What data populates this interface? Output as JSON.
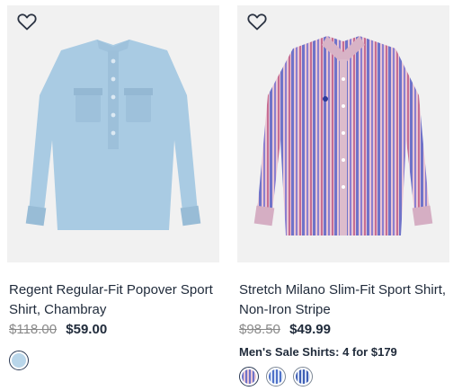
{
  "products": [
    {
      "title": "Regent Regular-Fit Popover Sport Shirt, Chambray",
      "original_price": "$118.00",
      "sale_price": "$59.00",
      "promo": "",
      "favorite_icon": "heart-outline-icon",
      "swatches": [
        {
          "color": "#b9d6ea",
          "selected": true
        }
      ]
    },
    {
      "title": "Stretch Milano Slim-Fit Sport Shirt, Non-Iron Stripe",
      "original_price": "$98.50",
      "sale_price": "$49.99",
      "promo": "Men's Sale Shirts: 4 for $179",
      "favorite_icon": "heart-outline-icon",
      "swatches": [
        {
          "color": "#9a8fd0",
          "selected": true
        },
        {
          "color": "#6f8fd6",
          "selected": false
        },
        {
          "color": "#5f7fc8",
          "selected": false
        }
      ]
    }
  ]
}
